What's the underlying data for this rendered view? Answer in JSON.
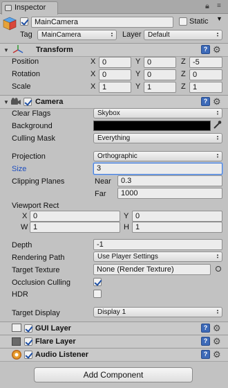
{
  "tab": {
    "title": "Inspector"
  },
  "header": {
    "name": "MainCamera",
    "static_label": "Static",
    "tag_label": "Tag",
    "tag_value": "MainCamera",
    "layer_label": "Layer",
    "layer_value": "Default"
  },
  "transform": {
    "title": "Transform",
    "position_label": "Position",
    "position": {
      "x": "0",
      "y": "0",
      "z": "-5"
    },
    "rotation_label": "Rotation",
    "rotation": {
      "x": "0",
      "y": "0",
      "z": "0"
    },
    "scale_label": "Scale",
    "scale": {
      "x": "1",
      "y": "1",
      "z": "1"
    },
    "x_label": "X",
    "y_label": "Y",
    "z_label": "Z"
  },
  "camera": {
    "title": "Camera",
    "clear_flags_label": "Clear Flags",
    "clear_flags": "Skybox",
    "background_label": "Background",
    "background_color": "#000000",
    "culling_mask_label": "Culling Mask",
    "culling_mask": "Everything",
    "projection_label": "Projection",
    "projection": "Orthographic",
    "size_label": "Size",
    "size": "3",
    "clipping_label": "Clipping Planes",
    "near_label": "Near",
    "near": "0.3",
    "far_label": "Far",
    "far": "1000",
    "viewport_label": "Viewport Rect",
    "vx_label": "X",
    "vx": "0",
    "vy_label": "Y",
    "vy": "0",
    "vw_label": "W",
    "vw": "1",
    "vh_label": "H",
    "vh": "1",
    "depth_label": "Depth",
    "depth": "-1",
    "rendering_path_label": "Rendering Path",
    "rendering_path": "Use Player Settings",
    "target_texture_label": "Target Texture",
    "target_texture": "None (Render Texture)",
    "occlusion_label": "Occlusion Culling",
    "hdr_label": "HDR",
    "target_display_label": "Target Display",
    "target_display": "Display 1"
  },
  "components": {
    "gui_layer": "GUI Layer",
    "flare_layer": "Flare Layer",
    "audio_listener": "Audio Listener"
  },
  "add_component": "Add Component",
  "colors": {
    "panel": "#c2c2c2",
    "accent": "#3d6ab8",
    "size_label": "#1f4fbf"
  }
}
